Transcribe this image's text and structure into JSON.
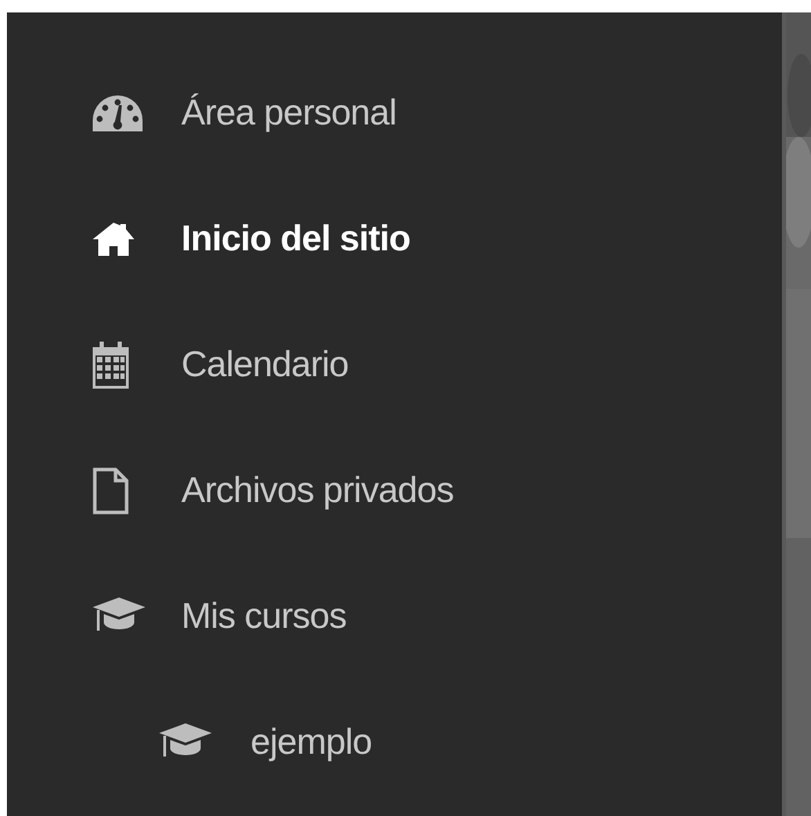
{
  "nav": {
    "items": [
      {
        "label": "Área personal",
        "selected": false
      },
      {
        "label": "Inicio del sitio",
        "selected": true
      },
      {
        "label": "Calendario",
        "selected": false
      },
      {
        "label": "Archivos privados",
        "selected": false
      },
      {
        "label": "Mis cursos",
        "selected": false,
        "children": [
          {
            "label": "ejemplo",
            "selected": false
          }
        ]
      }
    ]
  }
}
